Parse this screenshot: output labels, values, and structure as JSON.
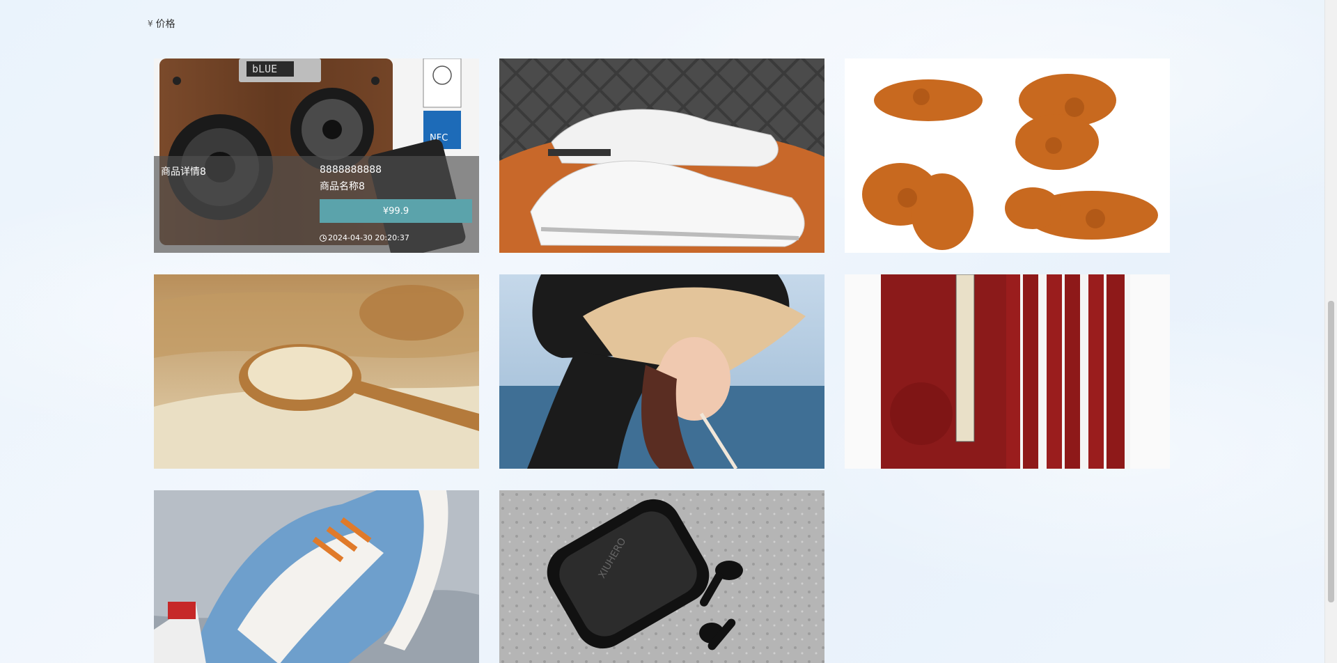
{
  "sort": {
    "icon": "yen-icon",
    "currency": "¥",
    "label": "价格"
  },
  "products": [
    {
      "image": "bluetooth-speaker-photo",
      "detail": "商品详情8",
      "price_raw": "8888888888",
      "name": "商品名称8",
      "price_button": "¥99.9",
      "time": "2024-04-30 20:20:37",
      "hovered": true
    },
    {
      "image": "white-sneakers-photo"
    },
    {
      "image": "fried-chicken-drumsticks-photo"
    },
    {
      "image": "rice-with-wooden-spoon-photo"
    },
    {
      "image": "woman-bucket-hat-sea-photo"
    },
    {
      "image": "red-history-books-photo"
    },
    {
      "image": "blue-sneakers-photo"
    },
    {
      "image": "wireless-earbuds-case-photo"
    }
  ],
  "colors": {
    "button": "#5ba3ab",
    "overlay": "rgba(80,80,80,0.65)"
  }
}
